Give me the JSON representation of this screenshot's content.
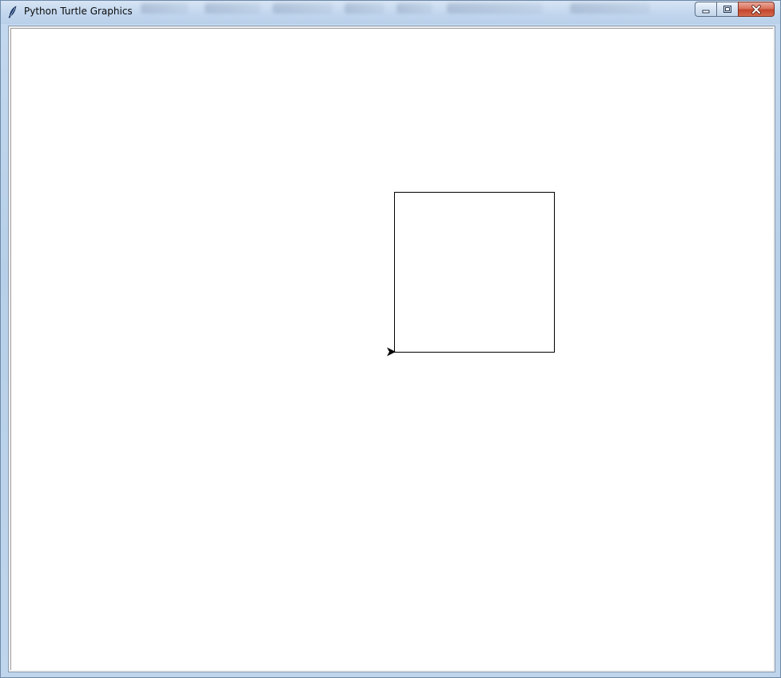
{
  "window": {
    "title": "Python Turtle Graphics"
  },
  "icons": {
    "app": "feather-icon",
    "minimize": "minimize-icon",
    "maximize": "maximize-icon",
    "close": "close-icon"
  },
  "colors": {
    "pen": "#000000",
    "canvas_background": "#ffffff",
    "close_button": "#c2452c"
  },
  "turtle": {
    "shape": "classic",
    "heading_degrees": 0
  }
}
